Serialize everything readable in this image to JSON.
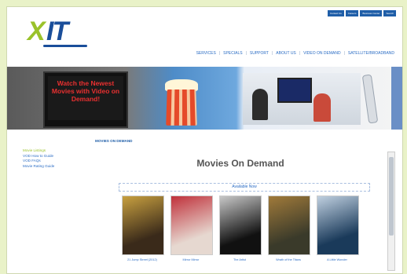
{
  "site": {
    "logo_text_a": "X",
    "logo_text_b": "IT"
  },
  "topbar": [
    "Contact Us",
    "Careers",
    "Business Center",
    "Search"
  ],
  "nav": [
    "SERVICES",
    "SPECIALS",
    "SUPPORT",
    "ABOUT US",
    "VIDEO ON DEMAND",
    "SATELLITE/BROADBAND"
  ],
  "banner": {
    "tv_text": "Watch the Newest Movies with Video on Demand!"
  },
  "breadcrumb": "MOVIES ON DEMAND",
  "sidebar": [
    "Movie Listings",
    "VOD How to Guide",
    "VOD FAQs",
    "Movie Rating Guide"
  ],
  "main": {
    "title": "Movies On Demand",
    "available": "Available Now",
    "movies": [
      {
        "caption": "21 Jump Street (2012)",
        "colors": [
          "#3a2a1a",
          "#c8a040"
        ]
      },
      {
        "caption": "Mirror Mirror",
        "colors": [
          "#e6d8d0",
          "#c0303a"
        ]
      },
      {
        "caption": "The Artist",
        "colors": [
          "#111111",
          "#c8c8c8"
        ]
      },
      {
        "caption": "Wrath of the Titans",
        "colors": [
          "#3a3a2a",
          "#a07a3a"
        ]
      },
      {
        "caption": "A Little Wonder",
        "colors": [
          "#1a3a5a",
          "#c0d0e0"
        ]
      }
    ]
  },
  "colors": {
    "accent_green": "#9ac22a",
    "brand_blue": "#1a4e9a",
    "link_blue": "#2a6cc4"
  }
}
